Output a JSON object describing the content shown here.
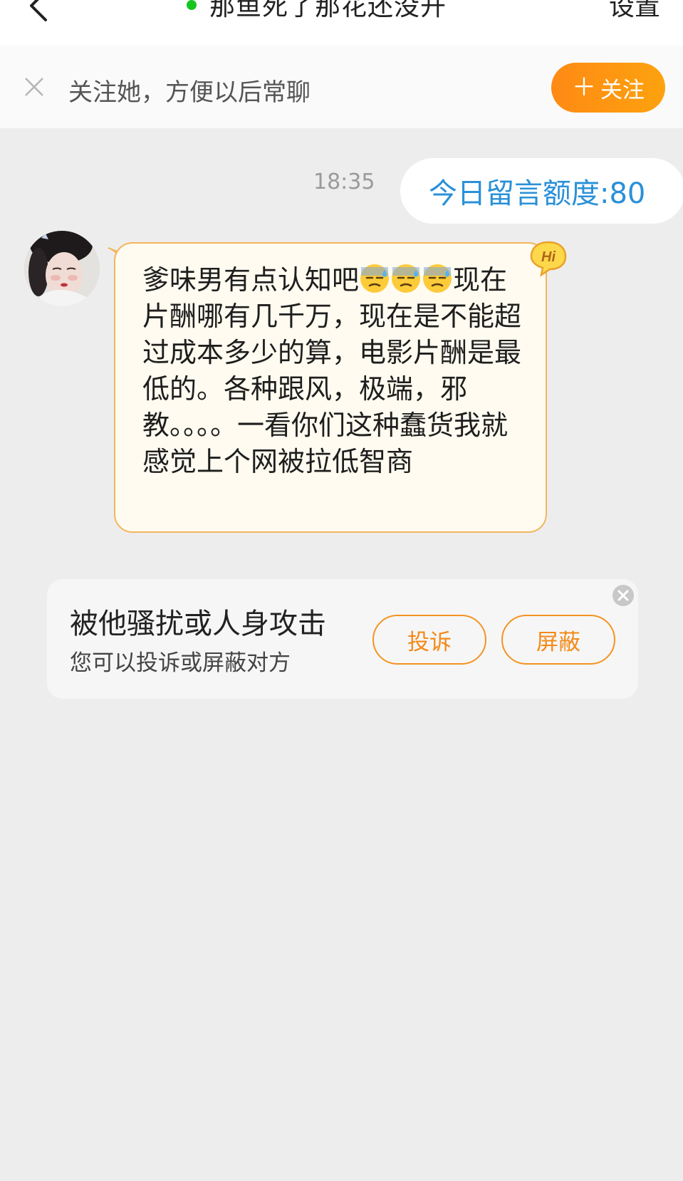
{
  "header": {
    "title": "那鱼死了那花还没开",
    "settings_label": "设置",
    "online_color": "#17c51f"
  },
  "follow_bar": {
    "tip": "关注她，方便以后常聊",
    "follow_label": "关注",
    "icons": [
      "close-icon",
      "plus-icon"
    ]
  },
  "messages": {
    "timestamp": "18:35",
    "quota_text": "今日留言额度:80",
    "incoming": {
      "text_part1": "爹味男有点认知吧",
      "emoji_count": 3,
      "emoji_name": "downcast-face-with-sweat",
      "text_part2": "现在片酬哪有几千万，现在是不能超过成本多少的算，电影片酬是最低的。各种跟风，极端，邪教。。。。一看你们这种蠢货我就感觉上个网被拉低智商",
      "badge": "Hi"
    }
  },
  "harass_card": {
    "title": "被他骚扰或人身攻击",
    "subtitle": "您可以投诉或屏蔽对方",
    "report_label": "投诉",
    "block_label": "屏蔽"
  },
  "colors": {
    "accent_orange": "#fd8f14",
    "link_blue": "#2a90d8",
    "bubble_border": "#f3b55a",
    "bubble_bg": "#fffbf0"
  }
}
